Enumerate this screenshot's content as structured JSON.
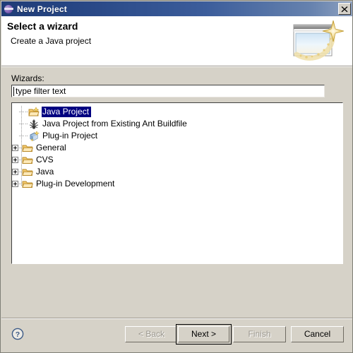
{
  "window": {
    "title": "New Project",
    "title_icon": "eclipse-icon",
    "close_label": "×",
    "close_icon": "close-icon"
  },
  "header": {
    "title": "Select a wizard",
    "description": "Create a Java project",
    "banner_icon": "wizard-sparkle-window-icon"
  },
  "form": {
    "wizards_label": "Wizards:",
    "filter_value": "type filter text",
    "filter_placeholder": "type filter text"
  },
  "tree": {
    "items": [
      {
        "label": "Java Project",
        "icon": "java-project-icon",
        "type": "leaf",
        "selected": true,
        "expandable": false
      },
      {
        "label": "Java Project from Existing Ant Buildfile",
        "icon": "ant-icon",
        "type": "leaf",
        "selected": false,
        "expandable": false
      },
      {
        "label": "Plug-in Project",
        "icon": "plugin-project-icon",
        "type": "leaf",
        "selected": false,
        "expandable": false
      },
      {
        "label": "General",
        "icon": "folder-icon",
        "type": "category",
        "selected": false,
        "expandable": true
      },
      {
        "label": "CVS",
        "icon": "folder-icon",
        "type": "category",
        "selected": false,
        "expandable": true
      },
      {
        "label": "Java",
        "icon": "folder-icon",
        "type": "category",
        "selected": false,
        "expandable": true
      },
      {
        "label": "Plug-in Development",
        "icon": "folder-icon",
        "type": "category",
        "selected": false,
        "expandable": true
      }
    ]
  },
  "footer": {
    "help_icon": "help-question-icon",
    "back_label": "< Back",
    "next_label": "Next >",
    "finish_label": "Finish",
    "cancel_label": "Cancel"
  },
  "colors": {
    "title_bar_start": "#1f3c77",
    "title_bar_end": "#8fa2c0",
    "dialog_face": "#d6d2c8",
    "selection": "#000080",
    "selection_text": "#ffffff",
    "disabled_text": "#9a968d",
    "folder": "#f5c96b"
  }
}
